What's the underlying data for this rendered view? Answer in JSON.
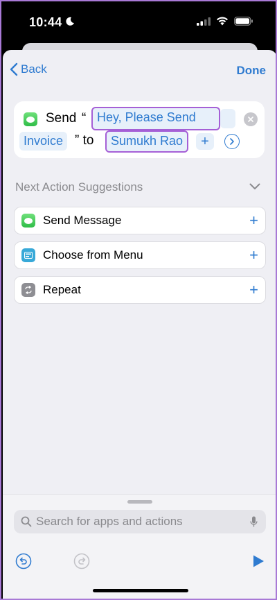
{
  "status": {
    "time": "10:44"
  },
  "nav": {
    "back_label": "Back",
    "done_label": "Done"
  },
  "action": {
    "verb": "Send",
    "open_quote": "“",
    "message_line1": "Hey, Please Send",
    "message_line2": "Invoice",
    "close_quote_to": "” to",
    "recipient": "Sumukh Rao",
    "plus": "+"
  },
  "suggestions": {
    "header": "Next Action Suggestions",
    "items": [
      {
        "label": "Send Message",
        "icon": "messages-icon"
      },
      {
        "label": "Choose from Menu",
        "icon": "menu-icon"
      },
      {
        "label": "Repeat",
        "icon": "repeat-icon"
      }
    ]
  },
  "search": {
    "placeholder": "Search for apps and actions"
  },
  "colors": {
    "accent": "#2f7bd0",
    "highlight": "#a55fd6",
    "sheet_bg": "#efeff4"
  }
}
